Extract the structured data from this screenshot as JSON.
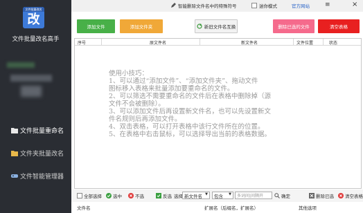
{
  "app": {
    "logo_top": "文件批量改名",
    "logo_char": "改",
    "name": "文件批量改名高手"
  },
  "sidebar": {
    "items": [
      {
        "label": "文件批量重命名",
        "icon": "folder-icon",
        "active": true
      },
      {
        "label": "文件夹批量改名",
        "icon": "folder-icon",
        "active": false
      },
      {
        "label": "文件智能管理器",
        "icon": "gamepad-icon",
        "active": false
      }
    ]
  },
  "topbar": {
    "special_chars": "智能删除文件名中的特殊符号",
    "mini_mode": "迷你模式",
    "official_site": "官方网站",
    "menu_icon": "menu-icon",
    "close_icon": "close-icon"
  },
  "toolbar": {
    "add_file": "添加文件",
    "add_folder": "添加文件夹",
    "new_name_rule": "新旧文件名互换",
    "delete_selected": "删除已选的文件",
    "clear_table": "清空表格"
  },
  "table": {
    "columns": [
      "序号",
      "原文件名",
      "新文件名",
      "文件位置",
      "状态"
    ]
  },
  "tips": [
    "使用小技巧：",
    "1、可以通过“添加文件”、“添加文件夹”、拖动文件",
    "图标移入表格来批量添加要重命名的文件。",
    "2、可以筛选不需要重命名的文件后在表格中删除掉（源",
    "文件不会被删除）。",
    "3、可以添加文件后再设置新文件名，也可以先设置新文",
    "件名规则后再添加文件。",
    "4、双击表格，可以打开表格中该行文件所在的位置。",
    "5、在表格中右击鼠标，可以选择导出当前的表格数据。"
  ],
  "bottombar": {
    "select_all": "全部选择",
    "select": "选中",
    "unselect": "不选",
    "invert": "反选",
    "choose": "选择:",
    "field": "新文件名",
    "match": "包含",
    "regex_placeholder": "多词间|间隔开",
    "ok": "确定",
    "delete_selected": "删除已选",
    "clear_table": "清空表格"
  },
  "bottom_labels": {
    "filename": "文件名",
    "extension": "扩展名（后缀名，扩展名）",
    "other": "其他选项"
  },
  "colors": {
    "sidebar_bg": "#2a2d33",
    "add_file": "#48b048",
    "add_folder": "#f0a838",
    "delete_selected": "#f56a8c",
    "clear_table": "#e82020",
    "site_link": "#2a64c8"
  }
}
